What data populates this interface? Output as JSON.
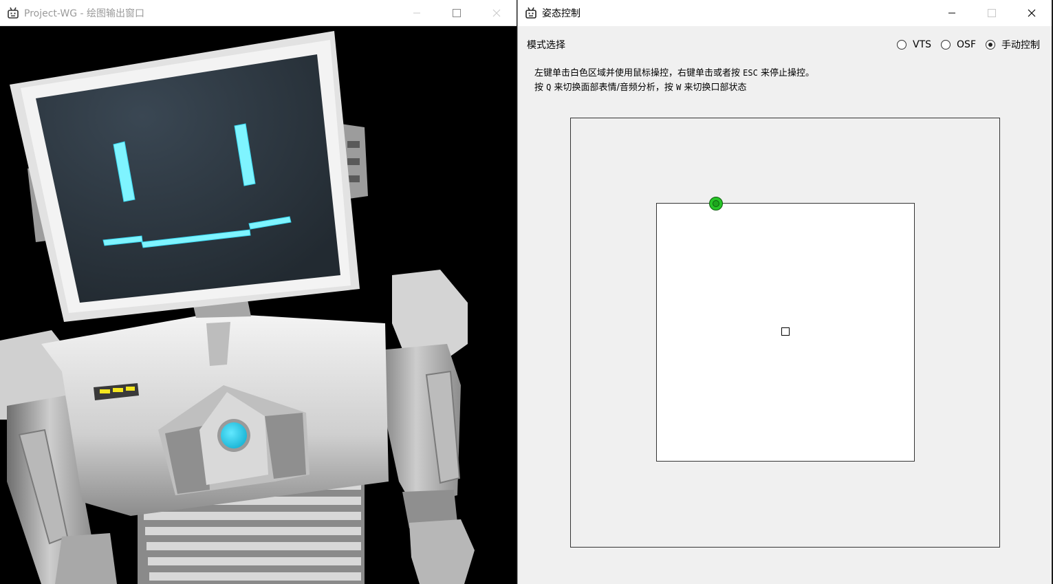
{
  "render_window": {
    "title": "Project-WG - 绘图输出窗口",
    "icon": "robot-icon",
    "controls": [
      "minimize-icon",
      "maximize-icon",
      "close-icon"
    ]
  },
  "control_window": {
    "title": "姿态控制",
    "icon": "robot-icon",
    "controls": [
      "minimize-icon",
      "maximize-icon",
      "close-icon"
    ],
    "mode_label": "模式选择",
    "modes": [
      {
        "label": "VTS",
        "selected": false
      },
      {
        "label": "OSF",
        "selected": false
      },
      {
        "label": "手动控制",
        "selected": true
      }
    ],
    "instructions": {
      "line1": {
        "a": "左键单击白色区域并使用鼠标操控，右键单击或者按",
        "key": "ESC",
        "b": "来停止操控。"
      },
      "line2": {
        "a": "按",
        "key1": "Q",
        "b": "来切换面部表情/音频分析，按",
        "key2": "W",
        "c": "来切换口部状态"
      }
    }
  },
  "colors": {
    "handle": "#27c427",
    "face_glow": "#7ff4ff",
    "chest_light": "#39d6f0",
    "indicator": "#f4e61e"
  }
}
